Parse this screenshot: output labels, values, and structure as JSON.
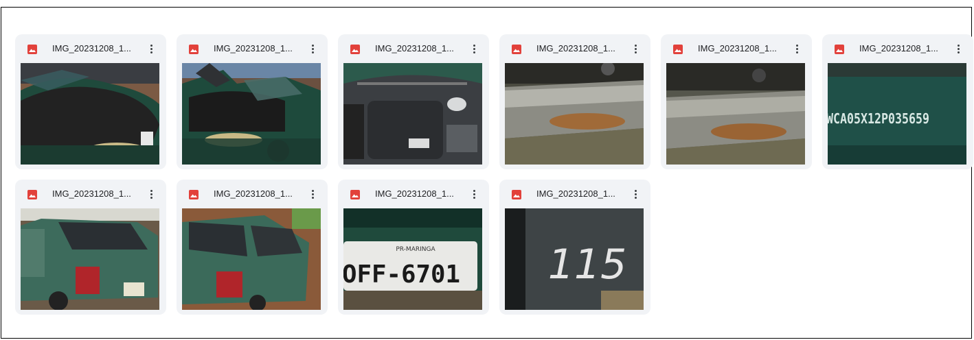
{
  "files": [
    {
      "name": "IMG_20231208_1...",
      "thumb": "car-front-hood-icon"
    },
    {
      "name": "IMG_20231208_1...",
      "thumb": "car-open-hood-icon"
    },
    {
      "name": "IMG_20231208_1...",
      "thumb": "engine-bay-icon"
    },
    {
      "name": "IMG_20231208_1...",
      "thumb": "chassis-number-icon"
    },
    {
      "name": "IMG_20231208_1...",
      "thumb": "chassis-number-icon"
    },
    {
      "name": "IMG_20231208_1...",
      "thumb": "vin-plate-icon",
      "overlay_text": "WCA05X12P035659"
    },
    {
      "name": "IMG_20231208_1...",
      "thumb": "car-rear-icon"
    },
    {
      "name": "IMG_20231208_1...",
      "thumb": "car-rear-icon"
    },
    {
      "name": "IMG_20231208_1...",
      "thumb": "license-plate-icon",
      "plate_region": "PR-MARINGA",
      "plate_number": "OFF-6701"
    },
    {
      "name": "IMG_20231208_1...",
      "thumb": "window-number-icon",
      "overlay_text": "115"
    }
  ],
  "colors": {
    "card_bg": "#f1f3f6",
    "image_icon": "#e2413b",
    "car_green": "#1f4a3c",
    "frame_border": "#000000"
  }
}
